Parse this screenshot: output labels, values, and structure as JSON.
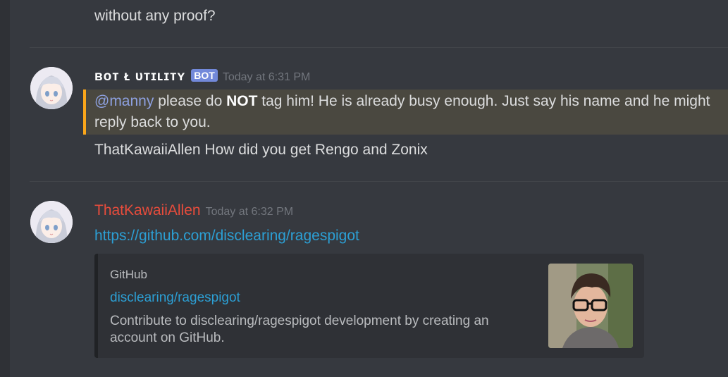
{
  "previous_message": {
    "text": "without any proof?"
  },
  "messages": [
    {
      "author": "ʙᴏᴛ ᴌ ᴜᴛɪʟɪᴛʏ",
      "bot_tag": "BOT",
      "timestamp": "Today at 6:31 PM",
      "highlighted_line": {
        "mention": "@manny",
        "text_before": " please do ",
        "bold": "NOT",
        "text_after": " tag him! He is already busy enough. Just say his name and he might",
        "text_line2": "reply back to you."
      },
      "second_line": "ThatKawaiiAllen How did you get Rengo and Zonix"
    },
    {
      "author": "ThatKawaiiAllen",
      "timestamp": "Today at 6:32 PM",
      "link": "https://github.com/disclearing/ragespigot",
      "embed": {
        "provider": "GitHub",
        "title": "disclearing/ragespigot",
        "description": "Contribute to disclearing/ragespigot development by creating an account on GitHub."
      }
    }
  ],
  "colors": {
    "background": "#36393f",
    "mention_highlight_bar": "#faa61a",
    "bot_tag": "#7289da",
    "link": "#2c9fd4",
    "username_red": "#e74c3c"
  }
}
